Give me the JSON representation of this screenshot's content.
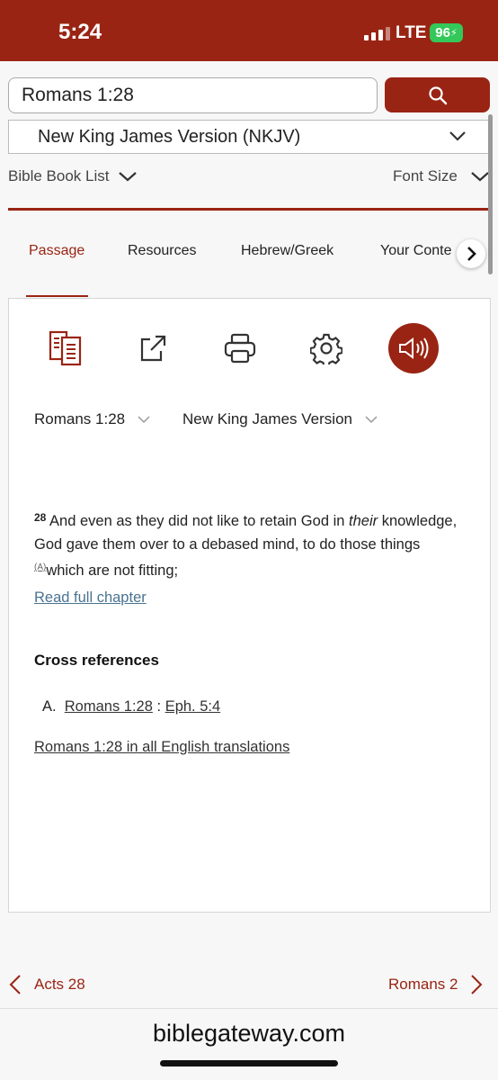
{
  "status_bar": {
    "time": "5:24",
    "network": "LTE",
    "battery": "96"
  },
  "search": {
    "value": "Romans 1:28",
    "button_icon": "search-icon"
  },
  "version_select": {
    "selected": "New King James Version (NKJV)"
  },
  "options_bar": {
    "book_list_label": "Bible Book List",
    "font_size_label": "Font Size"
  },
  "tabs": [
    {
      "label": "Passage",
      "active": true
    },
    {
      "label": "Resources",
      "active": false
    },
    {
      "label": "Hebrew/Greek",
      "active": false
    },
    {
      "label": "Your Conte",
      "active": false
    }
  ],
  "toolbar": {
    "icons": [
      "parallel-icon",
      "share-icon",
      "print-icon",
      "settings-icon",
      "audio-icon"
    ]
  },
  "passage_controls": {
    "reference": "Romans 1:28",
    "version": "New King James Version"
  },
  "verse": {
    "number": "28",
    "text_before_italic": "And even as they did not like to retain God in ",
    "italic": "their",
    "text_after_italic": " knowledge, God gave them over to a debased mind, to do those things ",
    "xref_letter": "(A)",
    "text_end": "which are not fitting;"
  },
  "read_full_chapter": "Read full chapter",
  "cross_references": {
    "title": "Cross references",
    "items": [
      {
        "letter": "A.",
        "ref": "Romans 1:28",
        "separator": ":",
        "target": "Eph. 5:4"
      }
    ]
  },
  "all_translations_link": "Romans 1:28 in all English translations",
  "bottom_nav": {
    "prev_label": "Acts 28",
    "next_label": "Romans 2"
  },
  "footer": {
    "domain": "biblegateway.com"
  },
  "colors": {
    "brand": "#9a2413",
    "link": "#4a7390",
    "battery": "#34c759"
  }
}
